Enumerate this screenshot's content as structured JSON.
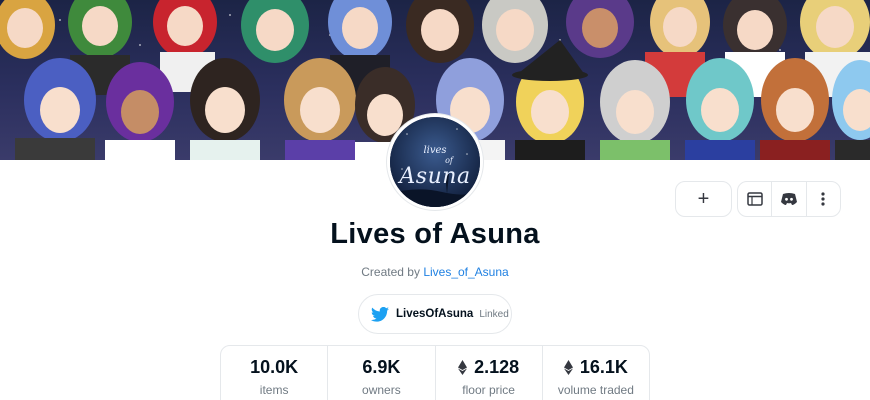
{
  "collection": {
    "title": "Lives of Asuna",
    "created_by_prefix": "Created by",
    "creator_name": "Lives_of_Asuna"
  },
  "avatar": {
    "line1": "lives",
    "line2": "of",
    "line3": "Asuna"
  },
  "actions": {
    "add_label": "+",
    "icons": [
      "website-icon",
      "discord-icon",
      "more-options-icon"
    ]
  },
  "twitter": {
    "handle": "LivesOfAsuna",
    "status": "Linked"
  },
  "stats": [
    {
      "value": "10.0K",
      "label": "items",
      "eth": false
    },
    {
      "value": "6.9K",
      "label": "owners",
      "eth": false
    },
    {
      "value": "2.128",
      "label": "floor price",
      "eth": true
    },
    {
      "value": "16.1K",
      "label": "volume traded",
      "eth": true
    }
  ],
  "colors": {
    "link": "#2081e2",
    "twitter": "#1da1f2",
    "muted": "#707a83",
    "text": "#04111d",
    "border": "#e5e8eb"
  }
}
